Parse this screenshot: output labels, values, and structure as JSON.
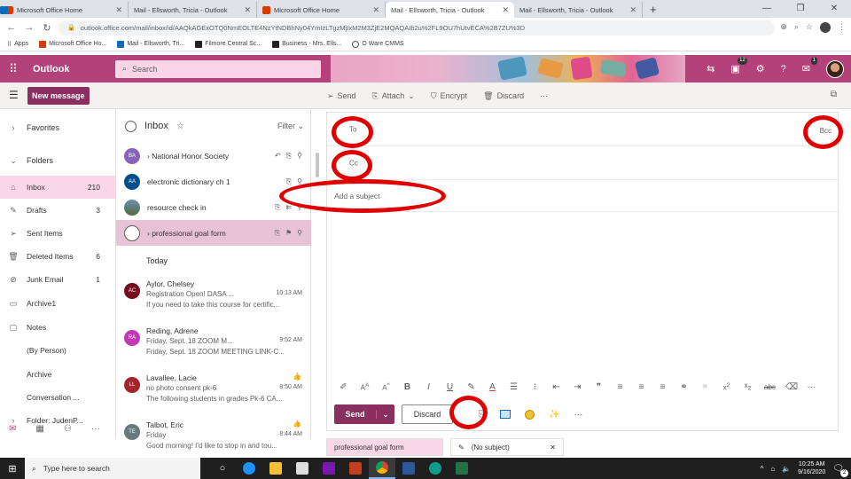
{
  "browser": {
    "tabs": [
      {
        "title": "Microsoft Office Home",
        "icon": "office-icon",
        "active": false
      },
      {
        "title": "Mail - Ellsworth, Tricia - Outlook",
        "icon": "outlook-icon",
        "active": false
      },
      {
        "title": "Microsoft Office Home",
        "icon": "office-icon",
        "active": false
      },
      {
        "title": "Mail - Ellsworth, Tricia - Outlook",
        "icon": "outlook-icon",
        "active": true
      },
      {
        "title": "Mail - Ellsworth, Tricia - Outlook",
        "icon": "outlook-icon",
        "active": false
      }
    ],
    "new_tab_label": "+",
    "url": "outlook.office.com/mail/inbox/id/AAQkAGExOTQ0NmEOLTE4NzYtNDBhNy04YmIzLTgzMjIxM2M3ZjE2MQAQAIb2u%2FL9OU7hUtvECA%2B7ZU%3D",
    "bookmarks": [
      {
        "label": "Apps",
        "icon": "apps-icon"
      },
      {
        "label": "Microsoft Office Ho...",
        "icon": "office-icon"
      },
      {
        "label": "Mail - Ellsworth, Tri...",
        "icon": "outlook-icon"
      },
      {
        "label": "Filmore Central Sc...",
        "icon": "blackboard-icon"
      },
      {
        "label": "Business - Mrs. Ells...",
        "icon": "blackboard-icon"
      },
      {
        "label": "O Ware CMMS",
        "icon": "oware-icon"
      }
    ]
  },
  "outlook": {
    "app_name": "Outlook",
    "search_placeholder": "Search",
    "header_icons": [
      "teams-icon",
      "calendar-badge-icon",
      "settings-icon",
      "help-icon",
      "feedback-icon",
      "avatar"
    ],
    "calendar_badge": "12",
    "feedback_badge": "1",
    "brand_color": "#b4427a"
  },
  "commandbar": {
    "new_message": "New message",
    "send": "Send",
    "attach": "Attach",
    "encrypt": "Encrypt",
    "discard": "Discard",
    "more": "···"
  },
  "leftnav": {
    "items": [
      {
        "label": "Favorites",
        "icon": "chevron-right-icon",
        "count": ""
      },
      {
        "label": "Folders",
        "icon": "chevron-down-icon",
        "count": ""
      },
      {
        "label": "Inbox",
        "icon": "inbox-icon",
        "count": "210",
        "selected": true
      },
      {
        "label": "Drafts",
        "icon": "pencil-icon",
        "count": "3"
      },
      {
        "label": "Sent Items",
        "icon": "send-icon",
        "count": ""
      },
      {
        "label": "Deleted Items",
        "icon": "trash-icon",
        "count": "6"
      },
      {
        "label": "Junk Email",
        "icon": "junk-icon",
        "count": "1"
      },
      {
        "label": "Archive1",
        "icon": "archive-icon",
        "count": ""
      },
      {
        "label": "Notes",
        "icon": "notes-icon",
        "count": ""
      },
      {
        "label": "(By Person)",
        "icon": "",
        "count": ""
      },
      {
        "label": "Archive",
        "icon": "",
        "count": ""
      },
      {
        "label": "Conversation ...",
        "icon": "",
        "count": ""
      },
      {
        "label": "Folder: JudenP...",
        "icon": "chevron-right-icon",
        "count": ""
      }
    ]
  },
  "messagelist": {
    "title": "Inbox",
    "filter": "Filter",
    "pinned": [
      {
        "initials": "BA",
        "color": "#8764b8",
        "text": "National Honor Society",
        "chevron": true
      },
      {
        "initials": "AA",
        "color": "#004e8c",
        "text": "electronic dictionary ch 1"
      },
      {
        "initials": "",
        "color": "#4f6b3a",
        "text": "resource check in"
      },
      {
        "initials": "",
        "color": "",
        "text": "professional goal form",
        "chevron": true,
        "selected": true
      }
    ],
    "today_label": "Today",
    "mails": [
      {
        "initials": "AC",
        "color": "#750b1c",
        "from": "Aylor, Chelsey",
        "subject": "Registration Open! DASA ...",
        "preview": "If you need to take this course for certific...",
        "time": "10:13 AM"
      },
      {
        "initials": "RA",
        "color": "#c239b3",
        "from": "Reding, Adrene",
        "subject": "Friday, Sept. 18 ZOOM M...",
        "preview": "Friday, Sept. 18 ZOOM MEETING LINK-C...",
        "time": "9:52 AM"
      },
      {
        "initials": "LL",
        "color": "#a4262c",
        "from": "Lavallee, Lacie",
        "subject": "no photo consent pk-6",
        "preview": "The following students in grades Pk-6 CA...",
        "time": "8:50 AM"
      },
      {
        "initials": "TE",
        "color": "#69797e",
        "from": "Talbot, Eric",
        "subject": "Friday",
        "preview": "Good morning! I'd like to stop in and tou...",
        "time": "8:44 AM"
      }
    ]
  },
  "compose": {
    "to_label": "To",
    "cc_label": "Cc",
    "bcc_label": "Bcc",
    "subject_placeholder": "Add a subject",
    "send_label": "Send",
    "discard_label": "Discard",
    "format_icons": [
      "format-painter-icon",
      "font-size-icon",
      "grow-font-icon",
      "bold-icon",
      "italic-icon",
      "underline-icon",
      "highlight-icon",
      "font-color-icon",
      "bullets-icon",
      "numbering-icon",
      "decrease-indent-icon",
      "increase-indent-icon",
      "quote-icon",
      "align-left-icon",
      "align-center-icon",
      "align-right-icon",
      "link-icon",
      "unlink-icon",
      "superscript-icon",
      "subscript-icon",
      "strikethrough-icon",
      "clear-format-icon",
      "more-icon"
    ]
  },
  "drafts": {
    "tab1": "professional goal form",
    "tab2": "(No subject)"
  },
  "taskbar": {
    "search": "Type here to search",
    "time": "10:25 AM",
    "date": "9/16/2020",
    "notifications": "2"
  },
  "annotations_color": "#e00000"
}
